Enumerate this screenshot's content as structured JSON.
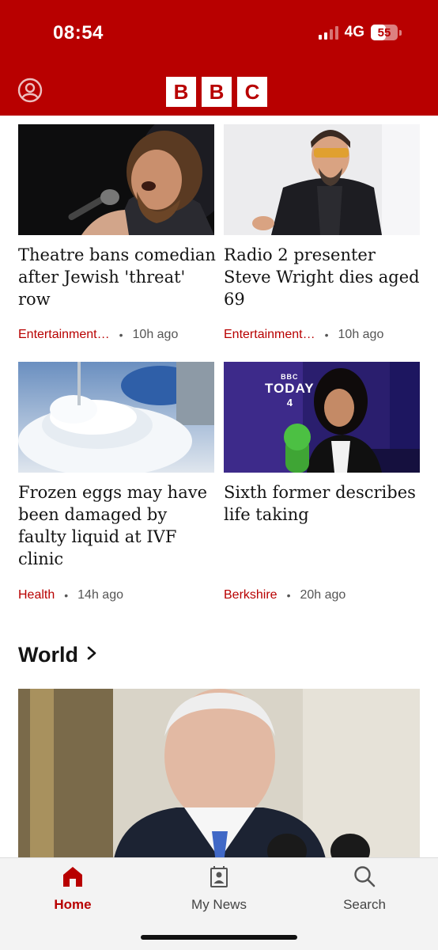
{
  "status_bar": {
    "time": "08:54",
    "network": "4G",
    "battery": "55",
    "battery_level": 0.55
  },
  "header": {
    "logo_letters": [
      "B",
      "B",
      "C"
    ],
    "icons": {
      "profile": "profile-icon"
    }
  },
  "stories": [
    {
      "headline": "Theatre bans comedian after Jewish 'threat' row",
      "category": "Entertainment…",
      "time": "10h ago"
    },
    {
      "headline": "Radio 2 presenter Steve Wright dies aged 69",
      "category": "Entertainment…",
      "time": "10h ago"
    },
    {
      "headline": "Frozen eggs may have been damaged by faulty liquid at IVF clinic",
      "category": "Health",
      "time": "14h ago"
    },
    {
      "headline": "Sixth former describes life taking",
      "category": "Berkshire",
      "time": "20h ago"
    }
  ],
  "today_graphic": {
    "badge": "BBC",
    "word": "TODAY",
    "digit": "4"
  },
  "section": {
    "title": "World",
    "icon": "chevron-right-icon"
  },
  "tabs": [
    {
      "label": "Home",
      "icon": "home-icon",
      "active": true
    },
    {
      "label": "My News",
      "icon": "my-news-icon",
      "active": false
    },
    {
      "label": "Search",
      "icon": "search-icon",
      "active": false
    }
  ],
  "colors": {
    "brand": "#b80000",
    "text": "#141414",
    "meta": "#555555"
  }
}
